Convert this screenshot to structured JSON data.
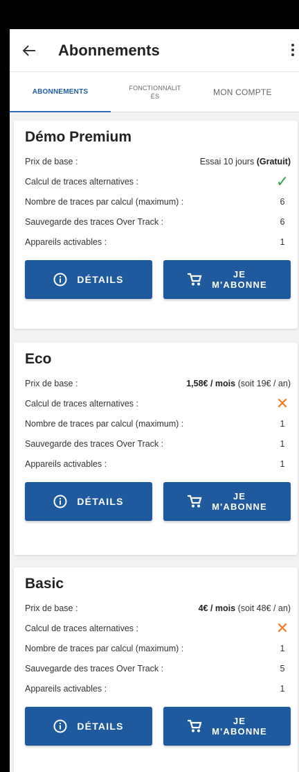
{
  "header": {
    "title": "Abonnements"
  },
  "tabs": [
    {
      "label": "ABONNEMENTS"
    },
    {
      "label": "FONCTIONNALITÉS"
    },
    {
      "label": "MON COMPTE"
    }
  ],
  "colors": {
    "accent": "#1f5a9e",
    "check": "#3aa04a",
    "cross": "#f07a25"
  },
  "plans": [
    {
      "name": "Démo Premium",
      "price_label": "Prix de base :",
      "price_text": "Essai 10 jours ",
      "price_bold": "(Gratuit)",
      "price_suffix": "",
      "alt_label": "Calcul de traces alternatives :",
      "alt_value": "✓",
      "alt_icon": "check-icon",
      "traces_label": "Nombre de traces par calcul (maximum) :",
      "traces_value": "6",
      "save_label": "Sauvegarde des traces Over Track :",
      "save_value": "6",
      "devices_label": "Appareils activables :",
      "devices_value": "1",
      "details_button": "DÉTAILS",
      "subscribe_line1": "JE",
      "subscribe_line2": "M'ABONNE"
    },
    {
      "name": "Eco",
      "price_label": "Prix de base :",
      "price_text": "",
      "price_bold": "1,58€ / mois",
      "price_suffix": " (soit 19€ / an)",
      "alt_label": "Calcul de traces alternatives :",
      "alt_value": "✕",
      "alt_icon": "cross-icon",
      "traces_label": "Nombre de traces par calcul (maximum) :",
      "traces_value": "1",
      "save_label": "Sauvegarde des traces Over Track :",
      "save_value": "1",
      "devices_label": "Appareils activables :",
      "devices_value": "1",
      "details_button": "DÉTAILS",
      "subscribe_line1": "JE",
      "subscribe_line2": "M'ABONNE"
    },
    {
      "name": "Basic",
      "price_label": "Prix de base :",
      "price_text": "",
      "price_bold": "4€ / mois",
      "price_suffix": " (soit 48€ / an)",
      "alt_label": "Calcul de traces alternatives :",
      "alt_value": "✕",
      "alt_icon": "cross-icon",
      "traces_label": "Nombre de traces par calcul (maximum) :",
      "traces_value": "1",
      "save_label": "Sauvegarde des traces Over Track :",
      "save_value": "5",
      "devices_label": "Appareils activables :",
      "devices_value": "1",
      "details_button": "DÉTAILS",
      "subscribe_line1": "JE",
      "subscribe_line2": "M'ABONNE"
    }
  ]
}
